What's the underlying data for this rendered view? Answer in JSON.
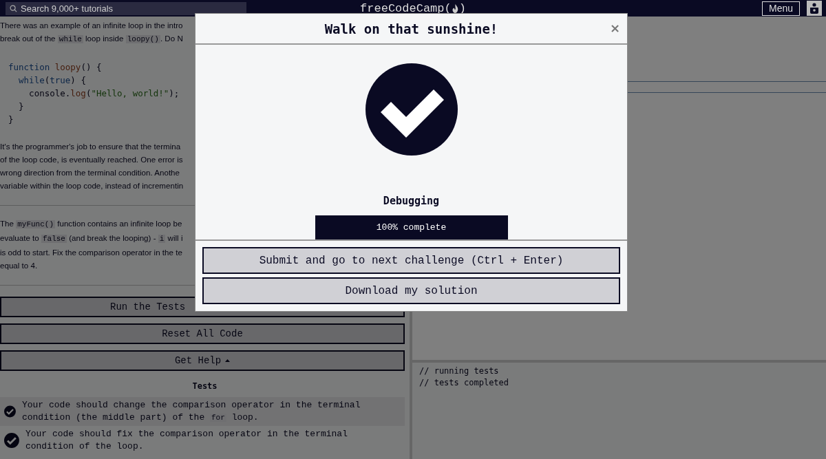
{
  "header": {
    "search": {
      "placeholder": "Search 9,000+ tutorials"
    },
    "logo": "freeCodeCamp(",
    "logo_end": ")",
    "menu_button": "Menu"
  },
  "lesson": {
    "paragraphs": [
      {
        "lines": [
          [
            {
              "kind": "text",
              "text": "There was an example of an infinite loop in the intro"
            }
          ],
          [
            {
              "kind": "text",
              "text": "break out of the "
            },
            {
              "kind": "code",
              "text": "while"
            },
            {
              "kind": "text",
              "text": " loop inside "
            },
            {
              "kind": "code",
              "text": "loopy()"
            },
            {
              "kind": "text",
              "text": ". Do N"
            }
          ]
        ]
      },
      {
        "code": [
          [
            {
              "kind": "keyword",
              "text": "function "
            },
            {
              "kind": "name",
              "text": "loopy"
            },
            {
              "kind": "plain",
              "text": "() {"
            }
          ],
          [
            {
              "kind": "keyword",
              "text": "  while"
            },
            {
              "kind": "plain",
              "text": "("
            },
            {
              "kind": "keyword",
              "text": "true"
            },
            {
              "kind": "plain",
              "text": ") {"
            }
          ],
          [
            {
              "kind": "plain",
              "text": "    console."
            },
            {
              "kind": "name",
              "text": "log"
            },
            {
              "kind": "plain",
              "text": "("
            },
            {
              "kind": "string",
              "text": "\"Hello, world!\""
            },
            {
              "kind": "plain",
              "text": ");"
            }
          ],
          [
            {
              "kind": "plain",
              "text": "  }"
            }
          ],
          [
            {
              "kind": "plain",
              "text": "}"
            }
          ]
        ]
      },
      {
        "lines": [
          [
            {
              "kind": "text",
              "text": "It's the programmer's job to ensure that the termina"
            }
          ],
          [
            {
              "kind": "text",
              "text": "of the loop code, is eventually reached. One error is"
            }
          ],
          [
            {
              "kind": "text",
              "text": "wrong direction from the terminal condition. Anothe"
            }
          ],
          [
            {
              "kind": "text",
              "text": "variable within the loop code, instead of incrementin"
            }
          ]
        ]
      },
      {
        "lines": [
          [
            {
              "kind": "text",
              "text": "The "
            },
            {
              "kind": "code",
              "text": "myFunc()"
            },
            {
              "kind": "text",
              "text": " function contains an infinite loop be"
            }
          ],
          [
            {
              "kind": "text",
              "text": "evaluate to "
            },
            {
              "kind": "code",
              "text": "false"
            },
            {
              "kind": "text",
              "text": " (and break the looping) - "
            },
            {
              "kind": "code",
              "text": "i"
            },
            {
              "kind": "text",
              "text": " will i"
            }
          ],
          [
            {
              "kind": "text",
              "text": "is odd to start. Fix the comparison operator in the te"
            }
          ],
          [
            {
              "kind": "text",
              "text": "equal to 4."
            }
          ]
        ],
        "rule_before": true
      }
    ]
  },
  "buttons": [
    {
      "kind": "run",
      "label": "Run the Tests"
    },
    {
      "kind": "reset",
      "label": "Reset All Code"
    },
    {
      "kind": "help",
      "label": "Get Help",
      "expanded": true
    }
  ],
  "tests": {
    "heading": "Tests",
    "items": [
      {
        "passed": true,
        "text": [
          {
            "kind": "text",
            "text": "Your code should change the comparison operator in the terminal condition (the middle part) of the "
          },
          {
            "kind": "code",
            "text": "for"
          },
          {
            "kind": "text",
            "text": " loop."
          }
        ]
      },
      {
        "passed": true,
        "text": [
          {
            "kind": "text",
            "text": "Your code should fix the comparison operator in the terminal condition of the loop."
          }
        ]
      }
    ]
  },
  "console": {
    "lines": [
      "// running tests",
      "// tests completed"
    ]
  },
  "modal": {
    "title": "Walk on that sunshine!",
    "close": "×",
    "challenge": "Debugging",
    "progress": {
      "level": 1,
      "label": "100% complete"
    },
    "buttons": [
      "Submit and go to next challenge (Ctrl + Enter)",
      "Download my solution"
    ]
  }
}
